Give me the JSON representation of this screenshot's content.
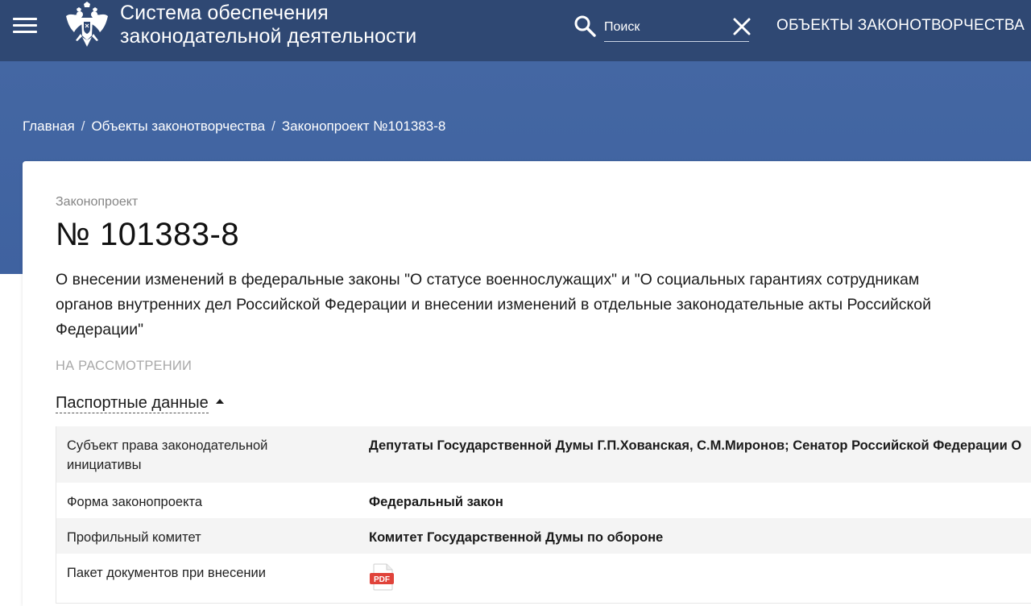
{
  "header": {
    "title_line1": "Система обеспечения",
    "title_line2": "законодательной деятельности",
    "search_placeholder": "Поиск",
    "nav_objects": "ОБЪЕКТЫ ЗАКОНОТВОРЧЕСТВА",
    "icons": [
      "hamburger-menu-icon",
      "state-emblem-icon",
      "search-icon",
      "close-icon"
    ],
    "bg_color": "#2f4873"
  },
  "band": {
    "bg_color": "#4467a3"
  },
  "breadcrumb": {
    "items": [
      "Главная",
      "Объекты законотворчества",
      "Законопроект №101383-8"
    ],
    "separator": "/"
  },
  "bill": {
    "type_label": "Законопроект",
    "number": "№ 101383-8",
    "description": "О внесении изменений в федеральные законы \"О статусе военнослужащих\" и \"О социальных гарантиях сотрудникам органов внутренних дел Российской Федерации и внесении изменений в отдельные законодательные акты Российской Федерации\"",
    "status": "НА РАССМОТРЕНИИ"
  },
  "passport": {
    "toggle_label": "Паспортные данные",
    "rows": [
      {
        "label": "Субъект права законодательной инициативы",
        "value": "Депутаты Государственной Думы Г.П.Хованская, С.М.Миронов; Сенатор Российской Федерации О"
      },
      {
        "label": "Форма законопроекта",
        "value": "Федеральный закон"
      },
      {
        "label": "Профильный комитет",
        "value": "Комитет Государственной Думы по обороне"
      },
      {
        "label": "Пакет документов при внесении",
        "value_icon": "pdf-icon",
        "pdf_text": "PDF"
      }
    ]
  }
}
